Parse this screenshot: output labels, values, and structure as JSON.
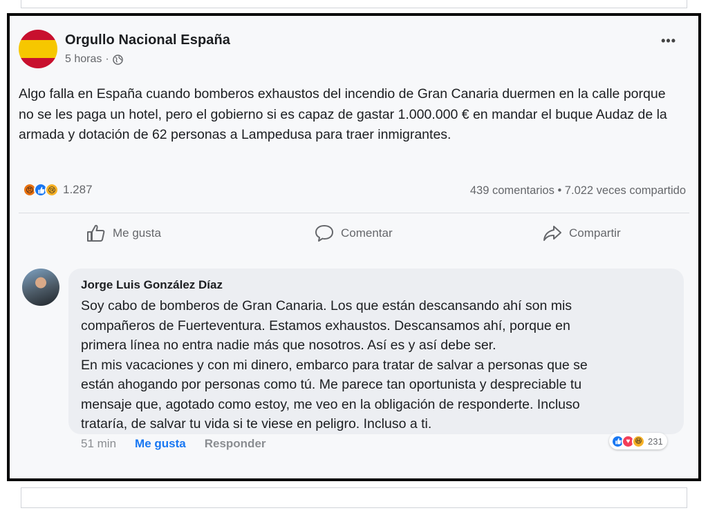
{
  "post": {
    "page_name": "Orgullo Nacional España",
    "time": "5 horas",
    "separator": "·",
    "body": "Algo falla en España cuando bomberos exhaustos del incendio de Gran Canaria duermen en la calle porque no se les paga un hotel, pero el gobierno si es capaz de gastar 1.000.000 € en mandar el buque Audaz de la armada y dotación de 62 personas a Lampedusa para traer inmigrantes.",
    "reaction_count": "1.287",
    "reactions": [
      "angry-icon",
      "like-icon",
      "sad-icon"
    ],
    "stats": "439 comentarios • 7.022 veces compartido",
    "actions": {
      "like": "Me gusta",
      "comment": "Comentar",
      "share": "Compartir"
    }
  },
  "comment": {
    "author": "Jorge Luis González Díaz",
    "text_lines": [
      "Soy cabo de bomberos de Gran Canaria. Los que están descansando ahí son mis",
      "compañeros de Fuerteventura. Estamos exhaustos. Descansamos ahí, porque en",
      "primera línea no entra nadie más que nosotros. Así es y así debe ser.",
      "En mis vacaciones y con mi dinero, embarco para tratar de salvar a personas que se",
      "están ahogando por personas como tú. Me parece tan oportunista y despreciable tu",
      "mensaje que, agotado como estoy, me veo en la obligación de responderte. Incluso",
      "trataría, de salvar tu vida si te viese en peligro. Incluso a ti."
    ],
    "time": "51 min",
    "like_label": "Me gusta",
    "reply_label": "Responder",
    "reaction_count": "231",
    "reactions": [
      "like-icon",
      "love-icon",
      "haha-icon"
    ]
  },
  "colors": {
    "accent": "#1877f2",
    "text": "#1c1e21",
    "muted": "#65676b",
    "bubble": "#eceef2"
  }
}
